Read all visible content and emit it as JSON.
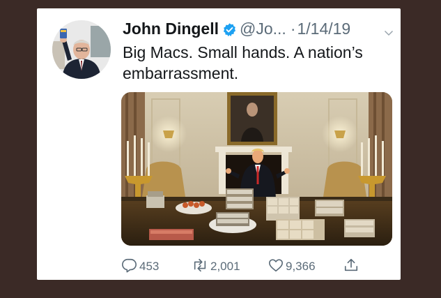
{
  "tweet": {
    "author_name": "John Dingell",
    "handle": "@Jo...",
    "separator": "·",
    "date": "1/14/19",
    "text": "Big Macs. Small hands. A nation’s embarrassment.",
    "verified": true,
    "actions": {
      "replies": "453",
      "retweets": "2,001",
      "likes": "9,366"
    }
  },
  "icons": {
    "verified": "verified-badge-icon",
    "menu": "chevron-down-icon",
    "reply": "reply-icon",
    "retweet": "retweet-icon",
    "like": "heart-icon",
    "share": "share-icon"
  },
  "colors": {
    "background": "#3b2a26",
    "card": "#ffffff",
    "text": "#14171a",
    "muted": "#5b6b78",
    "verified": "#1da1f2"
  }
}
